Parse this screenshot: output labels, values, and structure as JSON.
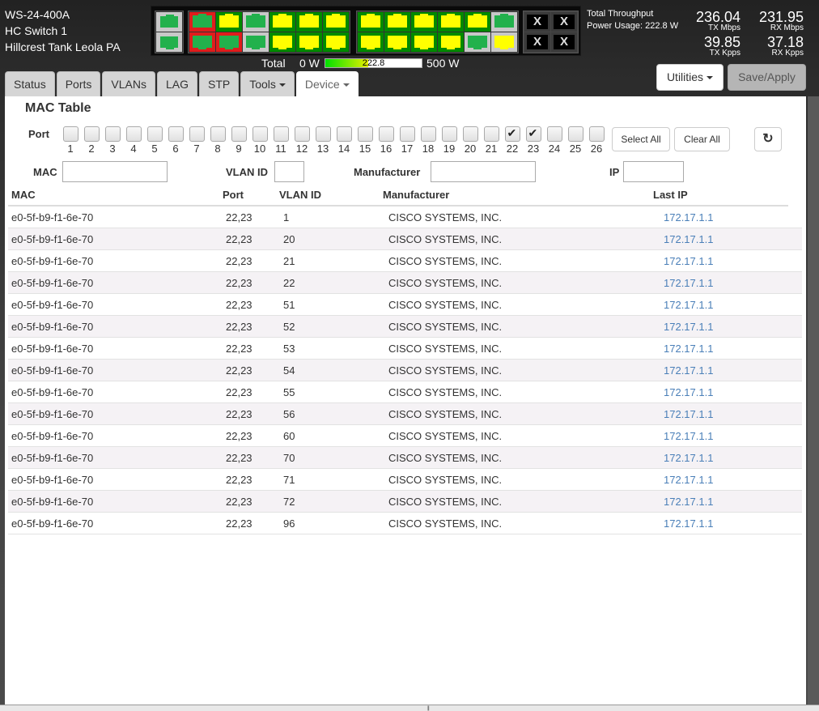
{
  "header": {
    "model": "WS-24-400A",
    "name": "HC Switch 1",
    "location": "Hillcrest Tank Leola PA"
  },
  "port_panel": {
    "colors": {
      "gray": "#c8c8c8",
      "green_bg": "#008a00",
      "red": "#e01c1c",
      "link_green": "#22b14c",
      "link_yellow": "#ffff00"
    },
    "sfp": [
      {
        "bg": "gray",
        "jack": "g"
      },
      {
        "bg": "gray",
        "jack": "g"
      }
    ],
    "group_b_top": [
      {
        "bg": "red",
        "jack": "g"
      },
      {
        "bg": "green",
        "jack": "y"
      },
      {
        "bg": "gray",
        "jack": "g"
      },
      {
        "bg": "green",
        "jack": "y"
      },
      {
        "bg": "green",
        "jack": "y"
      },
      {
        "bg": "green",
        "jack": "y"
      }
    ],
    "group_b_bottom": [
      {
        "bg": "red",
        "jack": "g"
      },
      {
        "bg": "red",
        "jack": "g"
      },
      {
        "bg": "gray",
        "jack": "g"
      },
      {
        "bg": "green",
        "jack": "y"
      },
      {
        "bg": "green",
        "jack": "y"
      },
      {
        "bg": "green",
        "jack": "y"
      }
    ],
    "group_c_top": [
      {
        "bg": "green",
        "jack": "y"
      },
      {
        "bg": "green",
        "jack": "y"
      },
      {
        "bg": "green",
        "jack": "y"
      },
      {
        "bg": "green",
        "jack": "y"
      },
      {
        "bg": "green",
        "jack": "y"
      },
      {
        "bg": "gray",
        "jack": "g"
      }
    ],
    "group_c_bottom": [
      {
        "bg": "green",
        "jack": "y"
      },
      {
        "bg": "green",
        "jack": "y"
      },
      {
        "bg": "green",
        "jack": "y"
      },
      {
        "bg": "green",
        "jack": "y"
      },
      {
        "bg": "gray",
        "jack": "g"
      },
      {
        "bg": "gray",
        "jack": "y"
      }
    ],
    "disabled_label": "X"
  },
  "power": {
    "total_label": "Total",
    "min_label": "0 W",
    "max_label": "500 W",
    "value": "222.8",
    "fraction": 0.4456
  },
  "stats": {
    "throughput_label": "Total Throughput",
    "power_usage": "Power Usage: 222.8 W",
    "tx_mbps": "236.04",
    "tx_mbps_unit": "TX Mbps",
    "rx_mbps": "231.95",
    "rx_mbps_unit": "RX Mbps",
    "tx_kpps": "39.85",
    "tx_kpps_unit": "TX Kpps",
    "rx_kpps": "37.18",
    "rx_kpps_unit": "RX Kpps"
  },
  "tabs": [
    {
      "label": "Status"
    },
    {
      "label": "Ports"
    },
    {
      "label": "VLANs"
    },
    {
      "label": "LAG"
    },
    {
      "label": "STP"
    },
    {
      "label": "Tools",
      "dropdown": true
    },
    {
      "label": "Device",
      "dropdown": true,
      "active": true
    }
  ],
  "toolbar": {
    "utilities": "Utilities",
    "save": "Save/Apply"
  },
  "mac_table": {
    "title": "MAC Table",
    "port_label": "Port",
    "ports": [
      {
        "n": "1",
        "checked": false
      },
      {
        "n": "2",
        "checked": false
      },
      {
        "n": "3",
        "checked": false
      },
      {
        "n": "4",
        "checked": false
      },
      {
        "n": "5",
        "checked": false
      },
      {
        "n": "6",
        "checked": false
      },
      {
        "n": "7",
        "checked": false
      },
      {
        "n": "8",
        "checked": false
      },
      {
        "n": "9",
        "checked": false
      },
      {
        "n": "10",
        "checked": false
      },
      {
        "n": "11",
        "checked": false
      },
      {
        "n": "12",
        "checked": false
      },
      {
        "n": "13",
        "checked": false
      },
      {
        "n": "14",
        "checked": false
      },
      {
        "n": "15",
        "checked": false
      },
      {
        "n": "16",
        "checked": false
      },
      {
        "n": "17",
        "checked": false
      },
      {
        "n": "18",
        "checked": false
      },
      {
        "n": "19",
        "checked": false
      },
      {
        "n": "20",
        "checked": false
      },
      {
        "n": "21",
        "checked": false
      },
      {
        "n": "22",
        "checked": true
      },
      {
        "n": "23",
        "checked": true
      },
      {
        "n": "24",
        "checked": false
      },
      {
        "n": "25",
        "checked": false
      },
      {
        "n": "26",
        "checked": false
      }
    ],
    "select_all": "Select All",
    "clear_all": "Clear All",
    "refresh_icon": "↻",
    "filters": {
      "mac_label": "MAC",
      "mac_value": "",
      "vlan_label": "VLAN ID",
      "vlan_value": "",
      "manufacturer_label": "Manufacturer",
      "manufacturer_value": "",
      "ip_label": "IP",
      "ip_value": ""
    },
    "columns": [
      "MAC",
      "Port",
      "VLAN ID",
      "Manufacturer",
      "Last IP"
    ],
    "rows": [
      {
        "mac": "e0-5f-b9-f1-6e-70",
        "port": "22,23",
        "vlan": "1",
        "mfr": "CISCO SYSTEMS, INC.",
        "ip": "172.17.1.1"
      },
      {
        "mac": "e0-5f-b9-f1-6e-70",
        "port": "22,23",
        "vlan": "20",
        "mfr": "CISCO SYSTEMS, INC.",
        "ip": "172.17.1.1"
      },
      {
        "mac": "e0-5f-b9-f1-6e-70",
        "port": "22,23",
        "vlan": "21",
        "mfr": "CISCO SYSTEMS, INC.",
        "ip": "172.17.1.1"
      },
      {
        "mac": "e0-5f-b9-f1-6e-70",
        "port": "22,23",
        "vlan": "22",
        "mfr": "CISCO SYSTEMS, INC.",
        "ip": "172.17.1.1"
      },
      {
        "mac": "e0-5f-b9-f1-6e-70",
        "port": "22,23",
        "vlan": "51",
        "mfr": "CISCO SYSTEMS, INC.",
        "ip": "172.17.1.1"
      },
      {
        "mac": "e0-5f-b9-f1-6e-70",
        "port": "22,23",
        "vlan": "52",
        "mfr": "CISCO SYSTEMS, INC.",
        "ip": "172.17.1.1"
      },
      {
        "mac": "e0-5f-b9-f1-6e-70",
        "port": "22,23",
        "vlan": "53",
        "mfr": "CISCO SYSTEMS, INC.",
        "ip": "172.17.1.1"
      },
      {
        "mac": "e0-5f-b9-f1-6e-70",
        "port": "22,23",
        "vlan": "54",
        "mfr": "CISCO SYSTEMS, INC.",
        "ip": "172.17.1.1"
      },
      {
        "mac": "e0-5f-b9-f1-6e-70",
        "port": "22,23",
        "vlan": "55",
        "mfr": "CISCO SYSTEMS, INC.",
        "ip": "172.17.1.1"
      },
      {
        "mac": "e0-5f-b9-f1-6e-70",
        "port": "22,23",
        "vlan": "56",
        "mfr": "CISCO SYSTEMS, INC.",
        "ip": "172.17.1.1"
      },
      {
        "mac": "e0-5f-b9-f1-6e-70",
        "port": "22,23",
        "vlan": "60",
        "mfr": "CISCO SYSTEMS, INC.",
        "ip": "172.17.1.1"
      },
      {
        "mac": "e0-5f-b9-f1-6e-70",
        "port": "22,23",
        "vlan": "70",
        "mfr": "CISCO SYSTEMS, INC.",
        "ip": "172.17.1.1"
      },
      {
        "mac": "e0-5f-b9-f1-6e-70",
        "port": "22,23",
        "vlan": "71",
        "mfr": "CISCO SYSTEMS, INC.",
        "ip": "172.17.1.1"
      },
      {
        "mac": "e0-5f-b9-f1-6e-70",
        "port": "22,23",
        "vlan": "72",
        "mfr": "CISCO SYSTEMS, INC.",
        "ip": "172.17.1.1"
      },
      {
        "mac": "e0-5f-b9-f1-6e-70",
        "port": "22,23",
        "vlan": "96",
        "mfr": "CISCO SYSTEMS, INC.",
        "ip": "172.17.1.1"
      }
    ]
  }
}
